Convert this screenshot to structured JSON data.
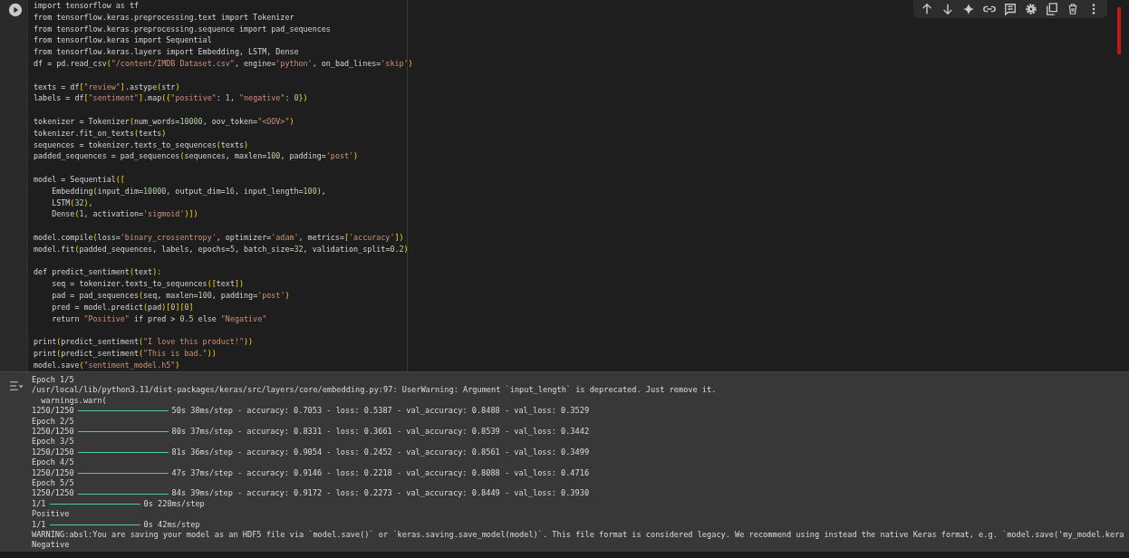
{
  "toolbar": {
    "buttons": [
      {
        "kind": "up"
      },
      {
        "kind": "down"
      },
      {
        "kind": "sparkle"
      },
      {
        "kind": "link"
      },
      {
        "kind": "comment"
      },
      {
        "kind": "settings"
      },
      {
        "kind": "mirror"
      },
      {
        "kind": "delete"
      },
      {
        "kind": "more"
      }
    ]
  },
  "code_cell": {
    "blocks": [
      [
        "import tensorflow as tf",
        "from tensorflow.keras.preprocessing.text import Tokenizer",
        "from tensorflow.keras.preprocessing.sequence import pad_sequences",
        "from tensorflow.keras import Sequential",
        "from tensorflow.keras.layers import Embedding, LSTM, Dense",
        "df = pd.read_csv(\"/content/IMDB Dataset.csv\", engine='python', on_bad_lines='skip')"
      ],
      [
        "texts = df[\"review\"].astype(str)",
        "labels = df[\"sentiment\"].map({\"positive\": 1, \"negative\": 0})"
      ],
      [
        "tokenizer = Tokenizer(num_words=10000, oov_token=\"<OOV>\")",
        "tokenizer.fit_on_texts(texts)",
        "sequences = tokenizer.texts_to_sequences(texts)",
        "padded_sequences = pad_sequences(sequences, maxlen=100, padding='post')"
      ],
      [
        "model = Sequential([",
        "    Embedding(input_dim=10000, output_dim=16, input_length=100),",
        "    LSTM(32),",
        "    Dense(1, activation='sigmoid')])"
      ],
      [
        "model.compile(loss='binary_crossentropy', optimizer='adam', metrics=['accuracy'])",
        "model.fit(padded_sequences, labels, epochs=5, batch_size=32, validation_split=0.2)"
      ],
      [
        "def predict_sentiment(text):",
        "    seq = tokenizer.texts_to_sequences([text])",
        "    pad = pad_sequences(seq, maxlen=100, padding='post')",
        "    pred = model.predict(pad)[0][0]",
        "    return \"Positive\" if pred > 0.5 else \"Negative\""
      ],
      [
        "print(predict_sentiment(\"I love this product!\"))",
        "print(predict_sentiment(\"This is bad.\"))",
        "model.save(\"sentiment_model.h5\")"
      ]
    ]
  },
  "output": {
    "lines": [
      {
        "kind": "text",
        "text": "Epoch 1/5"
      },
      {
        "kind": "text",
        "text": "/usr/local/lib/python3.11/dist-packages/keras/src/layers/core/embedding.py:97: UserWarning: Argument `input_length` is deprecated. Just remove it."
      },
      {
        "kind": "text",
        "text": "  warnings.warn("
      },
      {
        "kind": "progress",
        "count": "1250/1250",
        "level": 1,
        "stats": "50s 38ms/step - accuracy: 0.7053 - loss: 0.5387 - val_accuracy: 0.8488 - val_loss: 0.3529"
      },
      {
        "kind": "text",
        "text": "Epoch 2/5"
      },
      {
        "kind": "progress",
        "count": "1250/1250",
        "level": 1,
        "stats": "80s 37ms/step - accuracy: 0.8331 - loss: 0.3661 - val_accuracy: 0.8539 - val_loss: 0.3442"
      },
      {
        "kind": "text",
        "text": "Epoch 3/5"
      },
      {
        "kind": "progress",
        "count": "1250/1250",
        "level": 1,
        "stats": "81s 36ms/step - accuracy: 0.9054 - loss: 0.2452 - val_accuracy: 0.8561 - val_loss: 0.3499"
      },
      {
        "kind": "text",
        "text": "Epoch 4/5"
      },
      {
        "kind": "progress",
        "count": "1250/1250",
        "level": 1,
        "stats": "47s 37ms/step - accuracy: 0.9146 - loss: 0.2218 - val_accuracy: 0.8088 - val_loss: 0.4716"
      },
      {
        "kind": "text",
        "text": "Epoch 5/5"
      },
      {
        "kind": "progress",
        "count": "1250/1250",
        "level": 1,
        "stats": "84s 39ms/step - accuracy: 0.9172 - loss: 0.2273 - val_accuracy: 0.8449 - val_loss: 0.3930"
      },
      {
        "kind": "progress",
        "count": "1/1",
        "level": 1,
        "stats": "0s 220ms/step"
      },
      {
        "kind": "text",
        "text": "Positive"
      },
      {
        "kind": "progress",
        "count": "1/1",
        "level": 1,
        "stats": "0s 42ms/step"
      },
      {
        "kind": "text",
        "text": "WARNING:absl:You are saving your model as an HDF5 file via `model.save()` or `keras.saving.save_model(model)`. This file format is considered legacy. We recommend using instead the native Keras format, e.g. `model.save('my_model.kera"
      },
      {
        "kind": "text",
        "text": "Negative"
      }
    ]
  }
}
